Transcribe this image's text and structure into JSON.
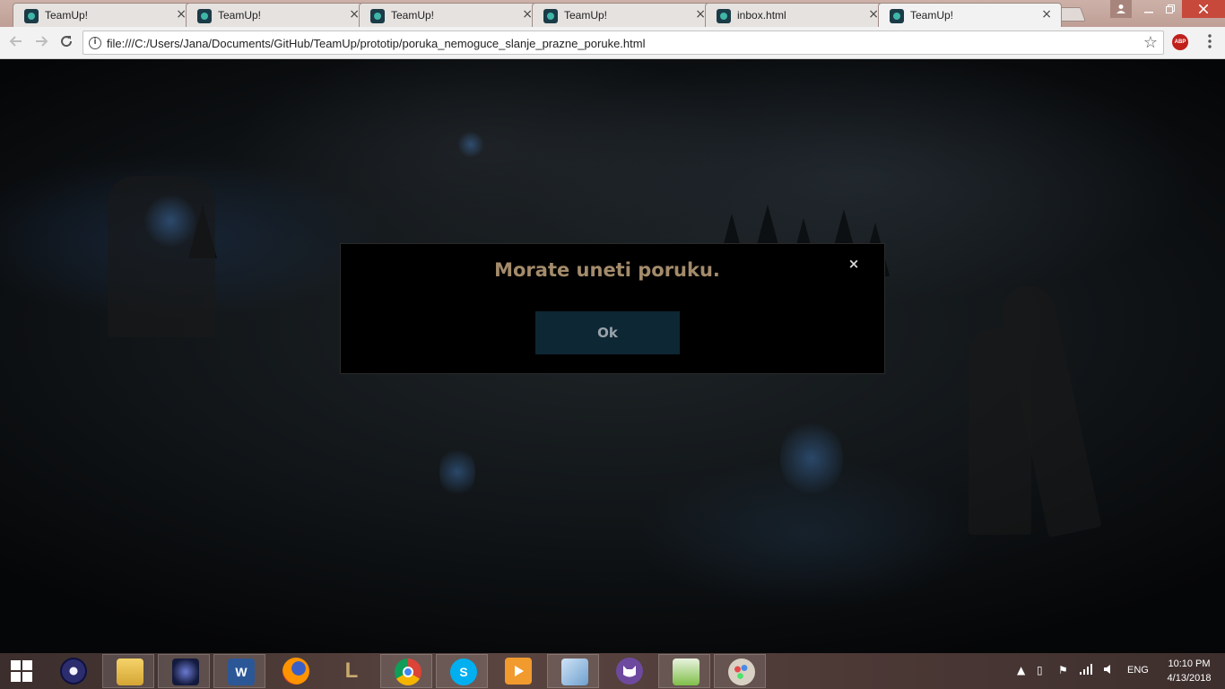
{
  "browser": {
    "tabs": [
      {
        "title": "TeamUp!",
        "active": false
      },
      {
        "title": "TeamUp!",
        "active": false
      },
      {
        "title": "TeamUp!",
        "active": false
      },
      {
        "title": "TeamUp!",
        "active": false
      },
      {
        "title": "inbox.html",
        "active": false
      },
      {
        "title": "TeamUp!",
        "active": true
      }
    ],
    "tab_close_glyph": "×",
    "url": "file:///C:/Users/Jana/Documents/GitHub/TeamUp/prototip/poruka_nemoguce_slanje_prazne_poruke.html",
    "extension_badge": "ABP",
    "icons": {
      "back": "back-arrow-icon",
      "forward": "forward-arrow-icon",
      "reload": "reload-icon",
      "info": "info-icon",
      "bookmark": "star-icon",
      "menu": "kebab-menu-icon"
    }
  },
  "modal": {
    "message": "Morate uneti poruku.",
    "close_glyph": "×",
    "ok_label": "Ok",
    "colors": {
      "message": "#a38b6b",
      "button_bg": "#0e2735",
      "button_text": "#9aa3aa"
    }
  },
  "taskbar": {
    "pinned": [
      {
        "name": "eclipse",
        "icon": "eclipse-icon"
      },
      {
        "name": "file-explorer",
        "icon": "folder-icon"
      },
      {
        "name": "game",
        "icon": "game-icon"
      },
      {
        "name": "word",
        "icon": "word-icon",
        "glyph": "W"
      },
      {
        "name": "firefox",
        "icon": "firefox-icon"
      },
      {
        "name": "league-of-legends",
        "icon": "league-icon",
        "glyph": "L"
      },
      {
        "name": "chrome",
        "icon": "chrome-icon"
      },
      {
        "name": "skype",
        "icon": "skype-icon",
        "glyph": "S"
      },
      {
        "name": "media-player",
        "icon": "play-icon"
      },
      {
        "name": "virtualbox",
        "icon": "cube-icon"
      },
      {
        "name": "github",
        "icon": "github-cat-icon"
      },
      {
        "name": "notepad-plus-plus",
        "icon": "notepad-icon"
      },
      {
        "name": "paint",
        "icon": "palette-icon"
      }
    ],
    "language": "ENG",
    "time": "10:10 PM",
    "date": "4/13/2018"
  }
}
